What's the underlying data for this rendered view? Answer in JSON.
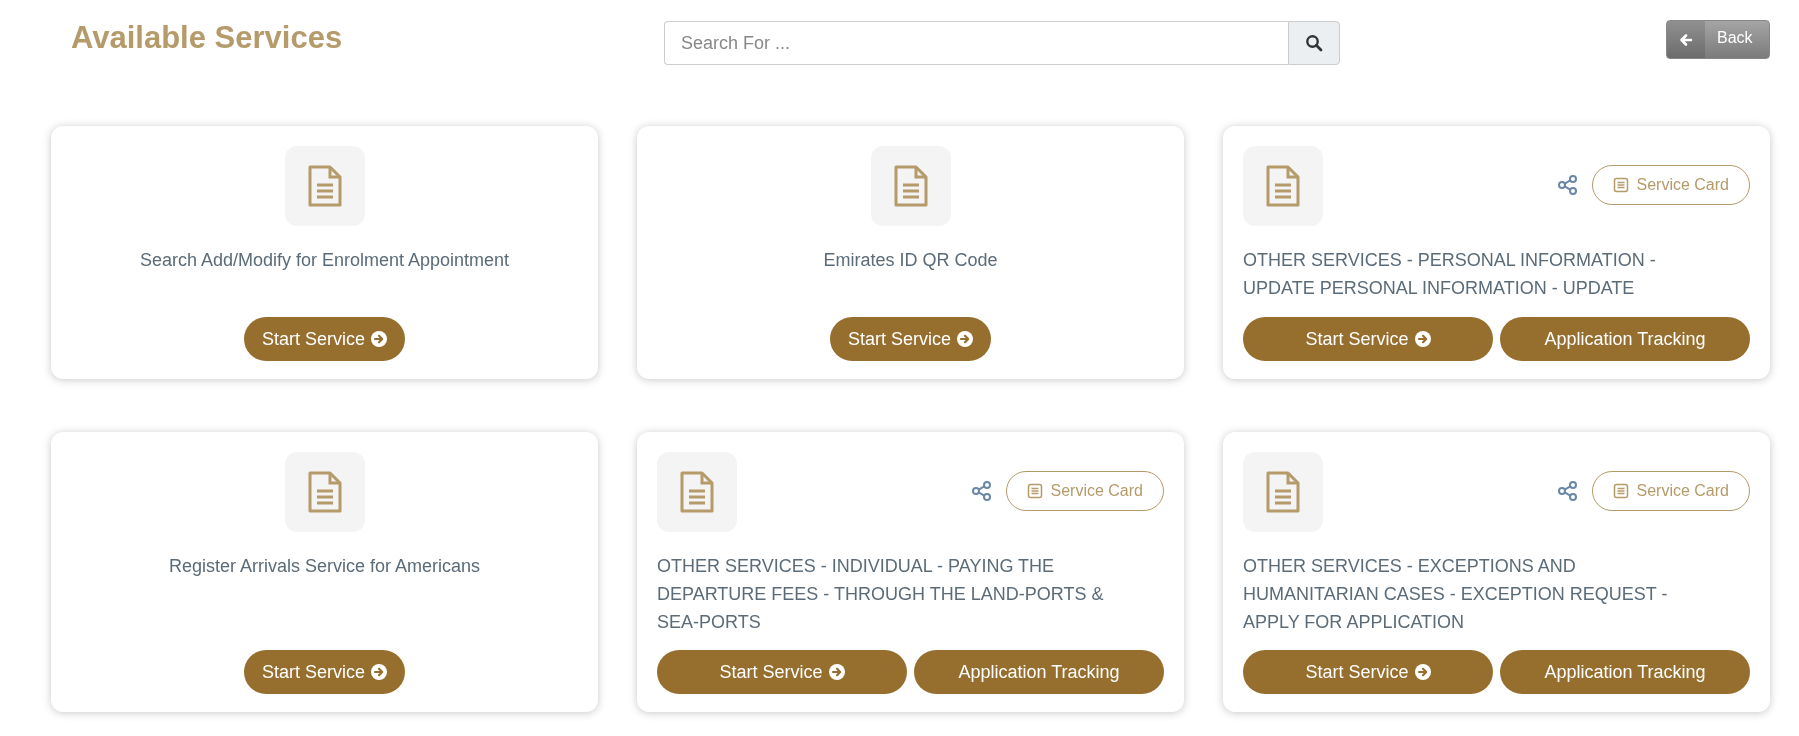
{
  "page_title": "Available Services",
  "search": {
    "placeholder": "Search For ..."
  },
  "back_button": {
    "label": "Back"
  },
  "services": [
    {
      "kind": "simple",
      "title": "Search Add/Modify for Enrolment Appointment",
      "start_label": "Start Service"
    },
    {
      "kind": "simple",
      "title": "Emirates ID QR Code",
      "start_label": "Start Service"
    },
    {
      "kind": "detailed",
      "title": "OTHER SERVICES - PERSONAL INFORMATION - UPDATE PERSONAL INFORMATION - UPDATE",
      "start_label": "Start Service",
      "card_label": "Service Card",
      "tracking_label": "Application Tracking"
    },
    {
      "kind": "simple",
      "title": "Register Arrivals Service for Americans",
      "start_label": "Start Service"
    },
    {
      "kind": "detailed",
      "title": "OTHER SERVICES - INDIVIDUAL - PAYING THE DEPARTURE FEES - THROUGH THE LAND-PORTS & SEA-PORTS",
      "start_label": "Start Service",
      "card_label": "Service Card",
      "tracking_label": "Application Tracking"
    },
    {
      "kind": "detailed",
      "title": "OTHER SERVICES - EXCEPTIONS AND HUMANITARIAN CASES - EXCEPTION REQUEST - APPLY FOR APPLICATION",
      "start_label": "Start Service",
      "card_label": "Service Card",
      "tracking_label": "Application Tracking"
    }
  ]
}
